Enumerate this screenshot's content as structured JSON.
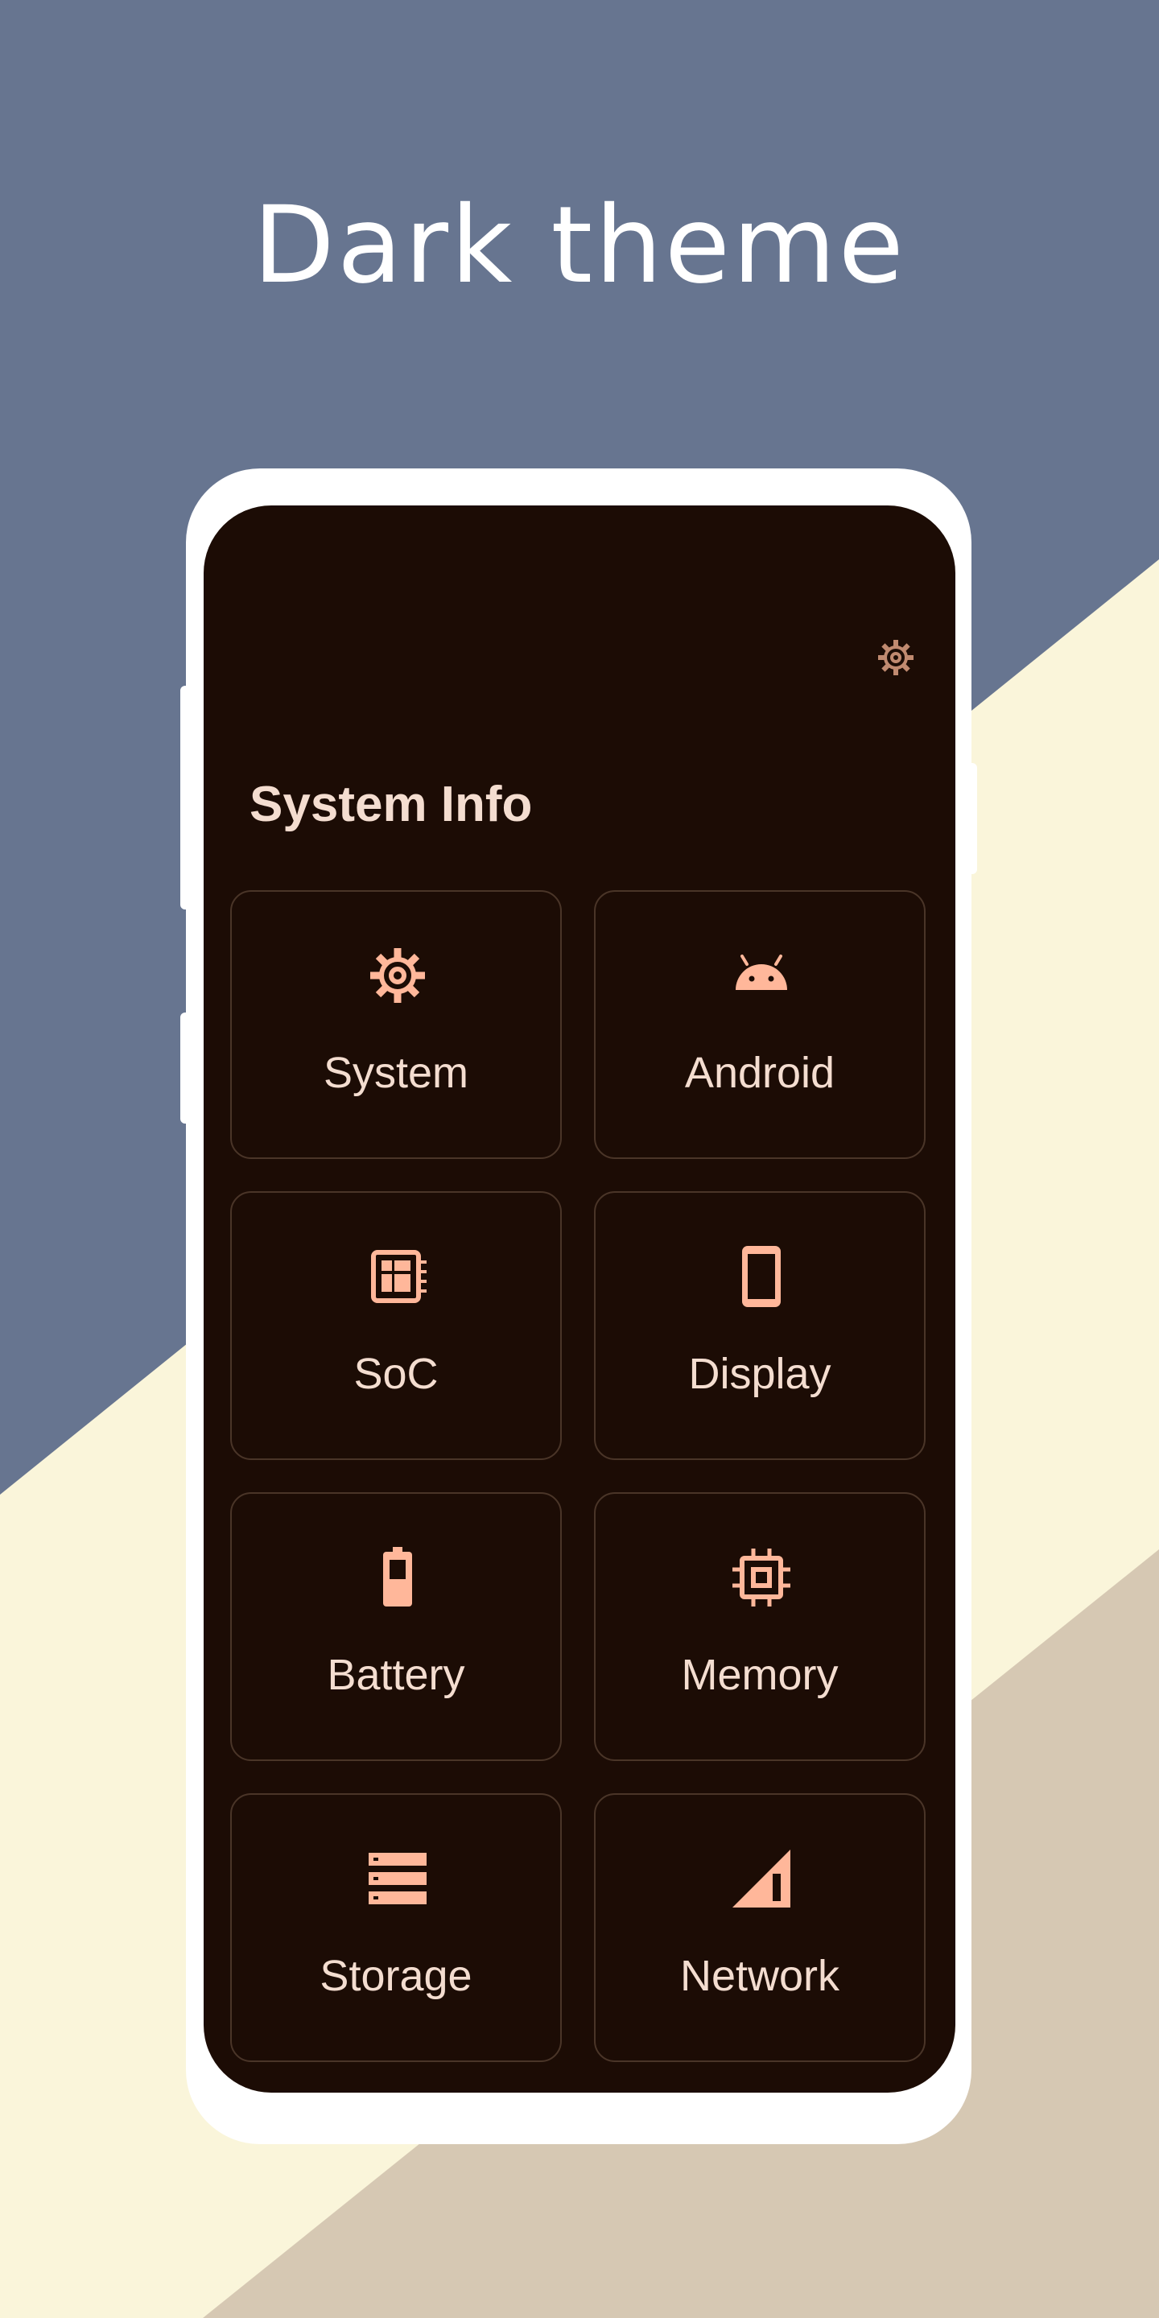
{
  "headline": "Dark theme",
  "screen": {
    "title": "System Info",
    "settings_icon": "gear-icon",
    "cards": [
      {
        "label": "System",
        "icon": "gear-icon"
      },
      {
        "label": "Android",
        "icon": "android-icon"
      },
      {
        "label": "SoC",
        "icon": "chip-board-icon"
      },
      {
        "label": "Display",
        "icon": "phone-icon"
      },
      {
        "label": "Battery",
        "icon": "battery-icon"
      },
      {
        "label": "Memory",
        "icon": "memory-chip-icon"
      },
      {
        "label": "Storage",
        "icon": "storage-icon"
      },
      {
        "label": "Network",
        "icon": "signal-icon"
      }
    ]
  },
  "colors": {
    "background_blue": "#677590",
    "background_cream": "#faf5da",
    "background_tan": "#d6c8b3",
    "screen_bg": "#1c0c05",
    "accent": "#ffb79a",
    "text": "#f4ddd0",
    "card_border": "#4a3528"
  }
}
